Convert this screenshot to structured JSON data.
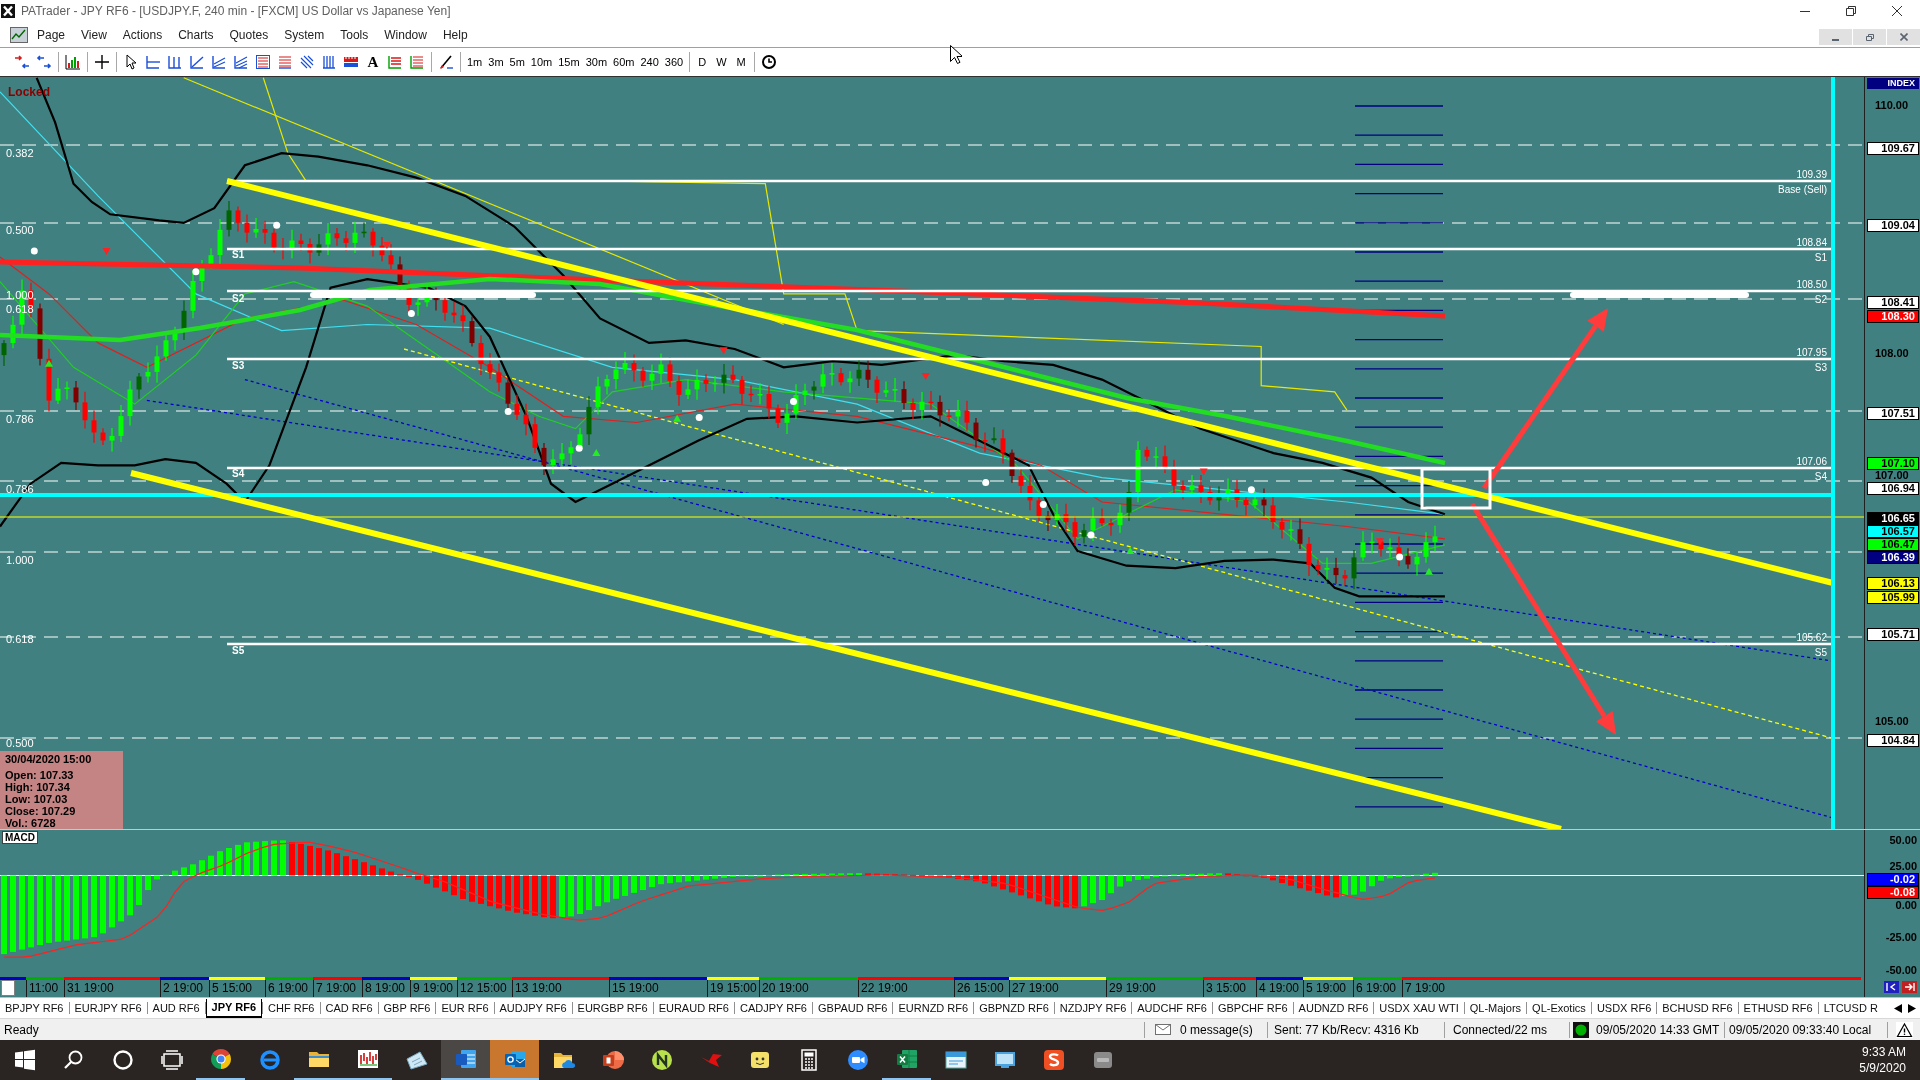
{
  "window": {
    "title": "PATrader - JPY RF6 - [USDJPY.F, 240 min - [FXCM] US Dollar vs Japanese Yen]"
  },
  "menu": [
    "Page",
    "View",
    "Actions",
    "Charts",
    "Quotes",
    "System",
    "Tools",
    "Window",
    "Help"
  ],
  "toolbar": {
    "text_tool": "A",
    "timeframes": [
      "1m",
      "3m",
      "5m",
      "10m",
      "15m",
      "30m",
      "60m",
      "240",
      "360"
    ],
    "periods": [
      "D",
      "W",
      "M"
    ]
  },
  "chart": {
    "lock_label": "Locked",
    "fib_labels": [
      "0.382",
      "0.500",
      "1.000",
      "0.618",
      "0.786",
      "0.786",
      "1.000",
      "0.618",
      "0.500"
    ],
    "support_labels": [
      "S1",
      "S2",
      "S3",
      "S4",
      "S5"
    ],
    "level_labels": [
      {
        "value": "109.39",
        "name": "Base (Sell)"
      },
      {
        "value": "108.84",
        "name": "S1"
      },
      {
        "value": "108.50",
        "name": "S2"
      },
      {
        "value": "107.95",
        "name": "S3"
      },
      {
        "value": "107.06",
        "name": "S4"
      },
      {
        "value": "105.62",
        "name": "S5"
      }
    ],
    "info": {
      "datetime": "30/04/2020 15:00",
      "lines": [
        "Open: 107.33",
        "High: 107.34",
        "Low: 107.03",
        "Close: 107.29",
        "Vol.: 6728"
      ]
    },
    "price_axis": {
      "index_label": "INDEX",
      "ticks": [
        "110.00",
        "108.00",
        "107.00",
        "105.00"
      ],
      "markers": [
        {
          "value": "109.67",
          "color": "#ffffff"
        },
        {
          "value": "109.04",
          "color": "#ffffff"
        },
        {
          "value": "108.41",
          "color": "#ffffff"
        },
        {
          "value": "108.30",
          "color": "#ff0000"
        },
        {
          "value": "107.51",
          "color": "#ffffff"
        },
        {
          "value": "107.10",
          "color": "#00ff00"
        },
        {
          "value": "106.94",
          "color": "#ffffff"
        },
        {
          "value": "106.65",
          "color": "#000000"
        },
        {
          "value": "106.57",
          "color": "#00ffff"
        },
        {
          "value": "106.47",
          "color": "#00ff00"
        },
        {
          "value": "106.39",
          "color": "#000080"
        },
        {
          "value": "106.13",
          "color": "#ffff00"
        },
        {
          "value": "105.99",
          "color": "#ffff00"
        },
        {
          "value": "105.71",
          "color": "#ffffff"
        },
        {
          "value": "104.84",
          "color": "#ffffff"
        }
      ]
    }
  },
  "macd": {
    "label": "MACD",
    "ticks": [
      "50.00",
      "25.00",
      "0.00",
      "-25.00",
      "-50.00"
    ],
    "markers": [
      {
        "value": "-0.02",
        "color": "#0000ff"
      },
      {
        "value": "-0.08",
        "color": "#ff0000"
      }
    ]
  },
  "time_axis": [
    "11:00",
    "31 19:00",
    "2 19:00",
    "5 15:00",
    "6 19:00",
    "7 19:00",
    "8 19:00",
    "9 19:00",
    "12 15:00",
    "13 19:00",
    "15 19:00",
    "19 15:00",
    "20 19:00",
    "22 19:00",
    "26 15:00",
    "27 19:00",
    "29 19:00",
    "3 15:00",
    "4 19:00",
    "5 19:00",
    "6 19:00",
    "7 19:00"
  ],
  "tabs": [
    {
      "label": "BPJPY RF6",
      "selected": false
    },
    {
      "label": "EURJPY RF6",
      "selected": false
    },
    {
      "label": "AUD RF6",
      "selected": false
    },
    {
      "label": "JPY RF6",
      "selected": true
    },
    {
      "label": "CHF RF6",
      "selected": false
    },
    {
      "label": "CAD RF6",
      "selected": false
    },
    {
      "label": "GBP RF6",
      "selected": false
    },
    {
      "label": "EUR RF6",
      "selected": false
    },
    {
      "label": "AUDJPY RF6",
      "selected": false
    },
    {
      "label": "EURGBP RF6",
      "selected": false
    },
    {
      "label": "EURAUD RF6",
      "selected": false
    },
    {
      "label": "CADJPY RF6",
      "selected": false
    },
    {
      "label": "GBPAUD RF6",
      "selected": false
    },
    {
      "label": "EURNZD RF6",
      "selected": false
    },
    {
      "label": "GBPNZD RF6",
      "selected": false
    },
    {
      "label": "NZDJPY RF6",
      "selected": false
    },
    {
      "label": "AUDCHF RF6",
      "selected": false
    },
    {
      "label": "GBPCHF RF6",
      "selected": false
    },
    {
      "label": "AUDNZD RF6",
      "selected": false
    },
    {
      "label": "USDX XAU WTI",
      "selected": false
    },
    {
      "label": "QL-Majors",
      "selected": false
    },
    {
      "label": "QL-Exotics",
      "selected": false
    },
    {
      "label": "USDX RF6",
      "selected": false
    },
    {
      "label": "BCHUSD RF6",
      "selected": false
    },
    {
      "label": "ETHUSD RF6",
      "selected": false
    },
    {
      "label": "LTCUSD R",
      "selected": false
    }
  ],
  "status_bar": {
    "state": "Ready",
    "messages": "0 message(s)",
    "traffic": "Sent: 77 Kb/Recv: 4316 Kb",
    "connection": "Connected/22 ms",
    "connected": true,
    "gmt_time": "09/05/2020 14:33 GMT",
    "local_time": "09/05/2020 09:33:40 Local"
  },
  "taskbar": {
    "buttons": [
      {
        "open": false,
        "selected": false,
        "highlighted": false
      },
      {
        "open": false,
        "selected": false,
        "highlighted": false
      },
      {
        "open": false,
        "selected": false,
        "highlighted": false
      },
      {
        "open": false,
        "selected": false,
        "highlighted": false
      },
      {
        "open": true,
        "selected": false,
        "highlighted": false
      },
      {
        "open": false,
        "selected": false,
        "highlighted": false
      },
      {
        "open": true,
        "selected": false,
        "highlighted": false
      },
      {
        "open": true,
        "selected": false,
        "highlighted": false
      },
      {
        "open": false,
        "selected": false,
        "highlighted": false
      },
      {
        "open": true,
        "selected": true,
        "highlighted": false
      },
      {
        "open": true,
        "selected": false,
        "highlighted": true
      },
      {
        "open": false,
        "selected": false,
        "highlighted": false
      },
      {
        "open": false,
        "selected": false,
        "highlighted": false
      },
      {
        "open": false,
        "selected": false,
        "highlighted": false
      },
      {
        "open": false,
        "selected": false,
        "highlighted": false
      },
      {
        "open": false,
        "selected": false,
        "highlighted": false
      },
      {
        "open": false,
        "selected": false,
        "highlighted": false
      },
      {
        "open": false,
        "selected": false,
        "highlighted": false
      },
      {
        "open": true,
        "selected": false,
        "highlighted": false
      },
      {
        "open": false,
        "selected": false,
        "highlighted": false
      },
      {
        "open": false,
        "selected": false,
        "highlighted": false
      },
      {
        "open": false,
        "selected": false,
        "highlighted": false
      },
      {
        "open": false,
        "selected": false,
        "highlighted": false
      }
    ],
    "time": "9:33 AM",
    "date": "5/9/2020"
  }
}
